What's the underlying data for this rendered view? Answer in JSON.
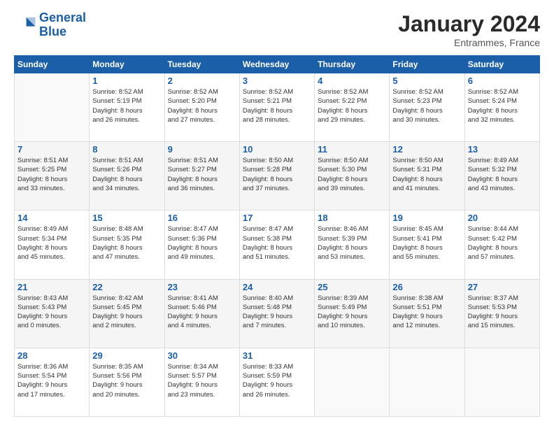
{
  "logo": {
    "line1": "General",
    "line2": "Blue"
  },
  "title": "January 2024",
  "subtitle": "Entrammes, France",
  "headers": [
    "Sunday",
    "Monday",
    "Tuesday",
    "Wednesday",
    "Thursday",
    "Friday",
    "Saturday"
  ],
  "weeks": [
    [
      {
        "day": "",
        "info": ""
      },
      {
        "day": "1",
        "info": "Sunrise: 8:52 AM\nSunset: 5:19 PM\nDaylight: 8 hours\nand 26 minutes."
      },
      {
        "day": "2",
        "info": "Sunrise: 8:52 AM\nSunset: 5:20 PM\nDaylight: 8 hours\nand 27 minutes."
      },
      {
        "day": "3",
        "info": "Sunrise: 8:52 AM\nSunset: 5:21 PM\nDaylight: 8 hours\nand 28 minutes."
      },
      {
        "day": "4",
        "info": "Sunrise: 8:52 AM\nSunset: 5:22 PM\nDaylight: 8 hours\nand 29 minutes."
      },
      {
        "day": "5",
        "info": "Sunrise: 8:52 AM\nSunset: 5:23 PM\nDaylight: 8 hours\nand 30 minutes."
      },
      {
        "day": "6",
        "info": "Sunrise: 8:52 AM\nSunset: 5:24 PM\nDaylight: 8 hours\nand 32 minutes."
      }
    ],
    [
      {
        "day": "7",
        "info": "Sunrise: 8:51 AM\nSunset: 5:25 PM\nDaylight: 8 hours\nand 33 minutes."
      },
      {
        "day": "8",
        "info": "Sunrise: 8:51 AM\nSunset: 5:26 PM\nDaylight: 8 hours\nand 34 minutes."
      },
      {
        "day": "9",
        "info": "Sunrise: 8:51 AM\nSunset: 5:27 PM\nDaylight: 8 hours\nand 36 minutes."
      },
      {
        "day": "10",
        "info": "Sunrise: 8:50 AM\nSunset: 5:28 PM\nDaylight: 8 hours\nand 37 minutes."
      },
      {
        "day": "11",
        "info": "Sunrise: 8:50 AM\nSunset: 5:30 PM\nDaylight: 8 hours\nand 39 minutes."
      },
      {
        "day": "12",
        "info": "Sunrise: 8:50 AM\nSunset: 5:31 PM\nDaylight: 8 hours\nand 41 minutes."
      },
      {
        "day": "13",
        "info": "Sunrise: 8:49 AM\nSunset: 5:32 PM\nDaylight: 8 hours\nand 43 minutes."
      }
    ],
    [
      {
        "day": "14",
        "info": "Sunrise: 8:49 AM\nSunset: 5:34 PM\nDaylight: 8 hours\nand 45 minutes."
      },
      {
        "day": "15",
        "info": "Sunrise: 8:48 AM\nSunset: 5:35 PM\nDaylight: 8 hours\nand 47 minutes."
      },
      {
        "day": "16",
        "info": "Sunrise: 8:47 AM\nSunset: 5:36 PM\nDaylight: 8 hours\nand 49 minutes."
      },
      {
        "day": "17",
        "info": "Sunrise: 8:47 AM\nSunset: 5:38 PM\nDaylight: 8 hours\nand 51 minutes."
      },
      {
        "day": "18",
        "info": "Sunrise: 8:46 AM\nSunset: 5:39 PM\nDaylight: 8 hours\nand 53 minutes."
      },
      {
        "day": "19",
        "info": "Sunrise: 8:45 AM\nSunset: 5:41 PM\nDaylight: 8 hours\nand 55 minutes."
      },
      {
        "day": "20",
        "info": "Sunrise: 8:44 AM\nSunset: 5:42 PM\nDaylight: 8 hours\nand 57 minutes."
      }
    ],
    [
      {
        "day": "21",
        "info": "Sunrise: 8:43 AM\nSunset: 5:43 PM\nDaylight: 9 hours\nand 0 minutes."
      },
      {
        "day": "22",
        "info": "Sunrise: 8:42 AM\nSunset: 5:45 PM\nDaylight: 9 hours\nand 2 minutes."
      },
      {
        "day": "23",
        "info": "Sunrise: 8:41 AM\nSunset: 5:46 PM\nDaylight: 9 hours\nand 4 minutes."
      },
      {
        "day": "24",
        "info": "Sunrise: 8:40 AM\nSunset: 5:48 PM\nDaylight: 9 hours\nand 7 minutes."
      },
      {
        "day": "25",
        "info": "Sunrise: 8:39 AM\nSunset: 5:49 PM\nDaylight: 9 hours\nand 10 minutes."
      },
      {
        "day": "26",
        "info": "Sunrise: 8:38 AM\nSunset: 5:51 PM\nDaylight: 9 hours\nand 12 minutes."
      },
      {
        "day": "27",
        "info": "Sunrise: 8:37 AM\nSunset: 5:53 PM\nDaylight: 9 hours\nand 15 minutes."
      }
    ],
    [
      {
        "day": "28",
        "info": "Sunrise: 8:36 AM\nSunset: 5:54 PM\nDaylight: 9 hours\nand 17 minutes."
      },
      {
        "day": "29",
        "info": "Sunrise: 8:35 AM\nSunset: 5:56 PM\nDaylight: 9 hours\nand 20 minutes."
      },
      {
        "day": "30",
        "info": "Sunrise: 8:34 AM\nSunset: 5:57 PM\nDaylight: 9 hours\nand 23 minutes."
      },
      {
        "day": "31",
        "info": "Sunrise: 8:33 AM\nSunset: 5:59 PM\nDaylight: 9 hours\nand 26 minutes."
      },
      {
        "day": "",
        "info": ""
      },
      {
        "day": "",
        "info": ""
      },
      {
        "day": "",
        "info": ""
      }
    ]
  ]
}
